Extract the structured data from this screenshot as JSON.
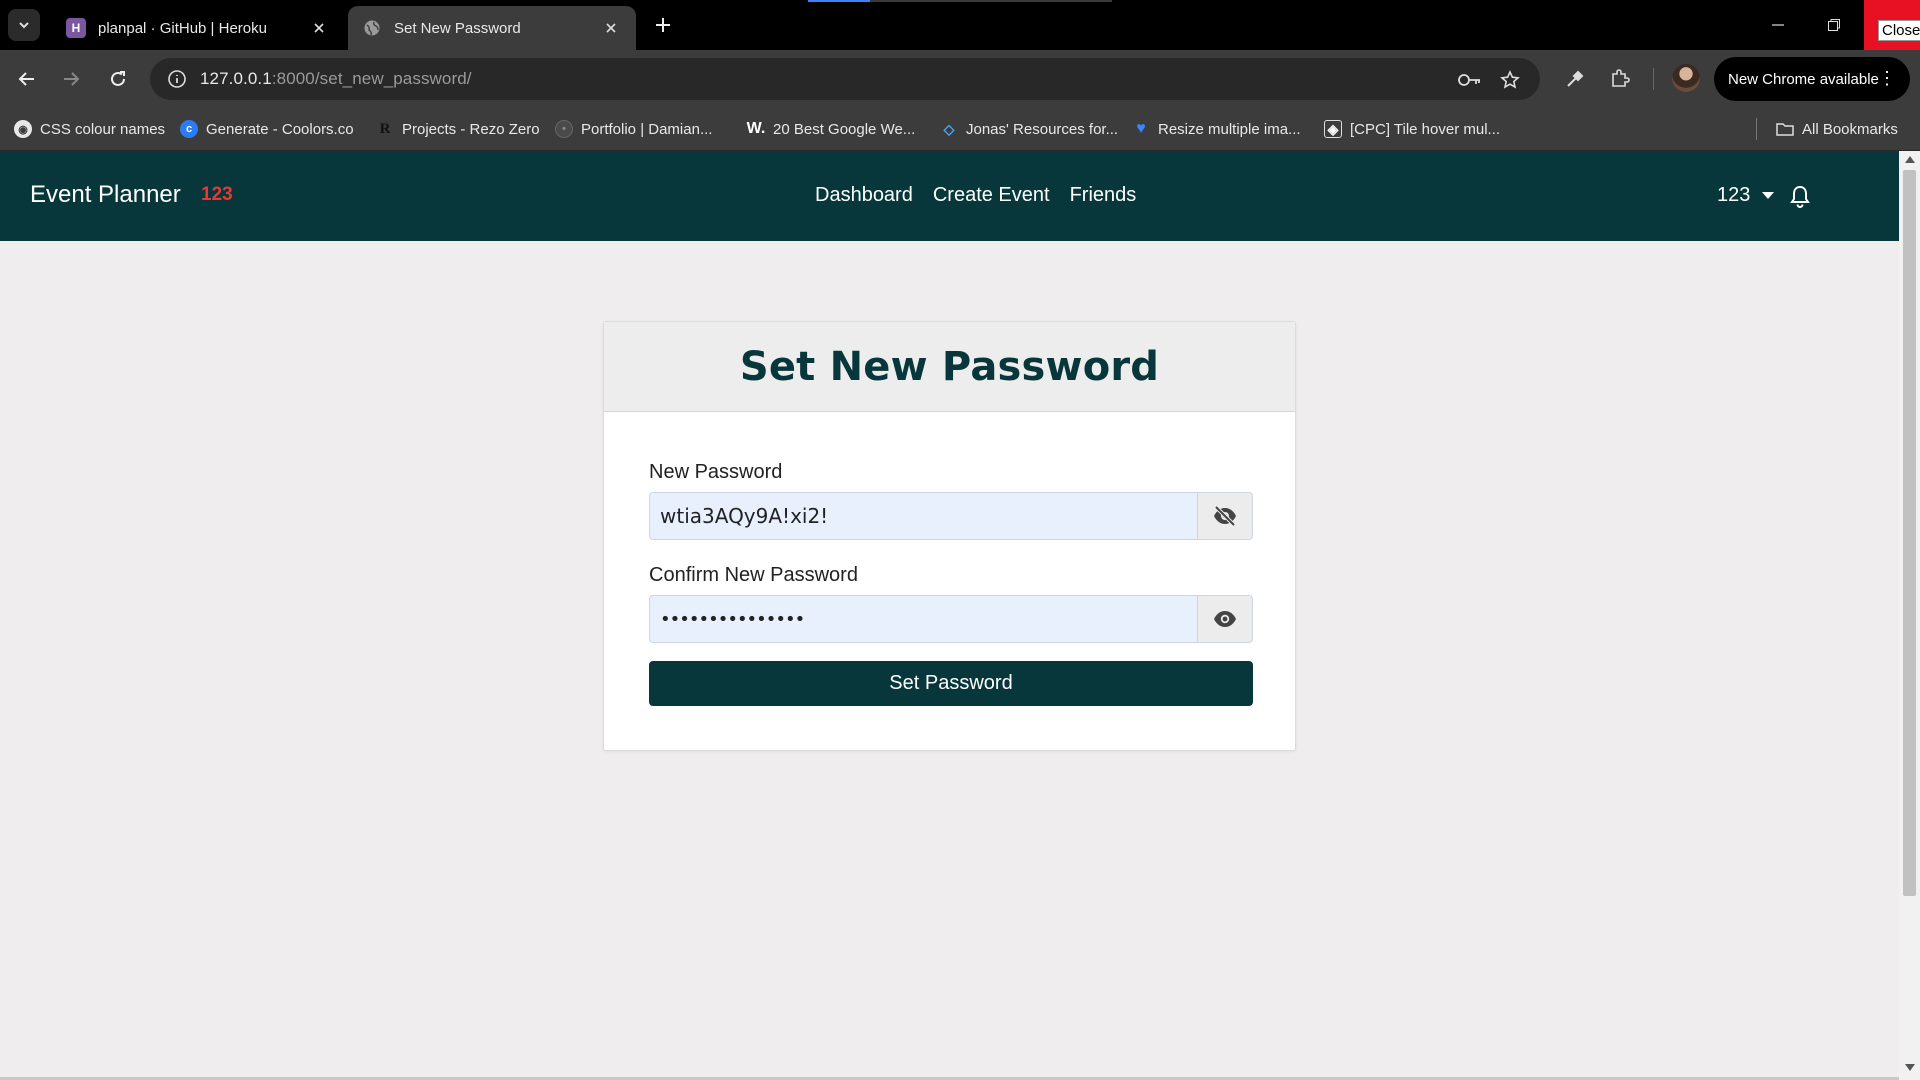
{
  "browser": {
    "tabs": [
      {
        "title": "planpal · GitHub | Heroku",
        "favicon": "heroku-icon"
      },
      {
        "title": "Set New Password",
        "favicon": "globe-icon"
      }
    ],
    "close_tooltip": "Close",
    "url_host": "127.0.0.1",
    "url_rest": ":8000/set_new_password/",
    "update_label": "New Chrome available",
    "bookmarks": [
      {
        "label": "CSS colour names",
        "icon": "globe-icon"
      },
      {
        "label": "Generate - Coolors.co",
        "icon": "coolors-icon"
      },
      {
        "label": "Projects - Rezo Zero",
        "icon": "rezo-icon"
      },
      {
        "label": "Portfolio | Damian...",
        "icon": "portfolio-icon"
      },
      {
        "label": "20 Best Google We...",
        "icon": "w-icon"
      },
      {
        "label": "Jonas' Resources for...",
        "icon": "diamond-icon"
      },
      {
        "label": "Resize multiple ima...",
        "icon": "heart-icon"
      },
      {
        "label": "[CPC] Tile hover mul...",
        "icon": "codepen-icon"
      }
    ],
    "all_bookmarks": "All Bookmarks"
  },
  "site": {
    "brand": "Event Planner",
    "brand_badge": "123",
    "nav": [
      "Dashboard",
      "Create Event",
      "Friends"
    ],
    "user": "123"
  },
  "form": {
    "title": "Set New Password",
    "new_password_label": "New Password",
    "new_password_value": "wtia3AQy9A!xi2!",
    "confirm_label": "Confirm New Password",
    "confirm_value": "•••••••••••••••",
    "submit_label": "Set Password"
  },
  "colors": {
    "primary": "#07363b",
    "badge": "#e53935",
    "autofill": "#e8f0fe"
  }
}
